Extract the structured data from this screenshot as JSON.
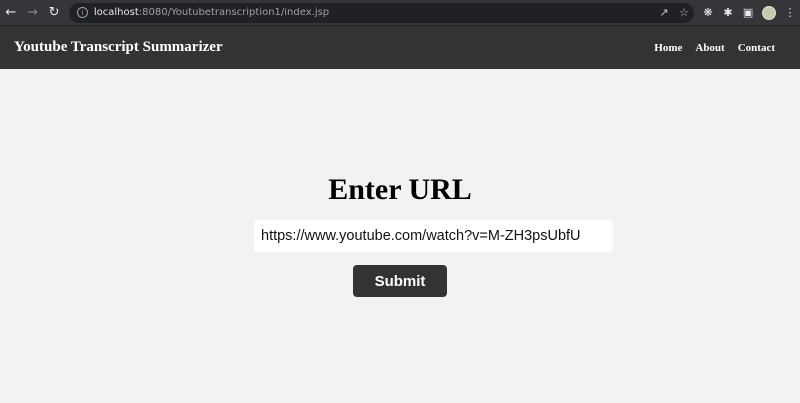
{
  "browser": {
    "url_host": "localhost",
    "url_path": ":8080/Youtubetranscription1/index.jsp",
    "icons": [
      "back-icon",
      "forward-icon",
      "reload-icon",
      "info-icon",
      "share-icon",
      "star-icon",
      "extension-icon",
      "puzzle-icon",
      "sidepanel-icon",
      "profile-avatar",
      "menu-icon"
    ]
  },
  "navbar": {
    "brand": "Youtube Transcript Summarizer",
    "links": [
      "Home",
      "About",
      "Contact"
    ]
  },
  "main": {
    "heading": "Enter URL",
    "url_value": "https://www.youtube.com/watch?v=M-ZH3psUbfU",
    "submit_label": "Submit"
  },
  "colors": {
    "navbar_bg": "#333333",
    "page_bg": "#f2f2f2",
    "button_bg": "#333333"
  }
}
